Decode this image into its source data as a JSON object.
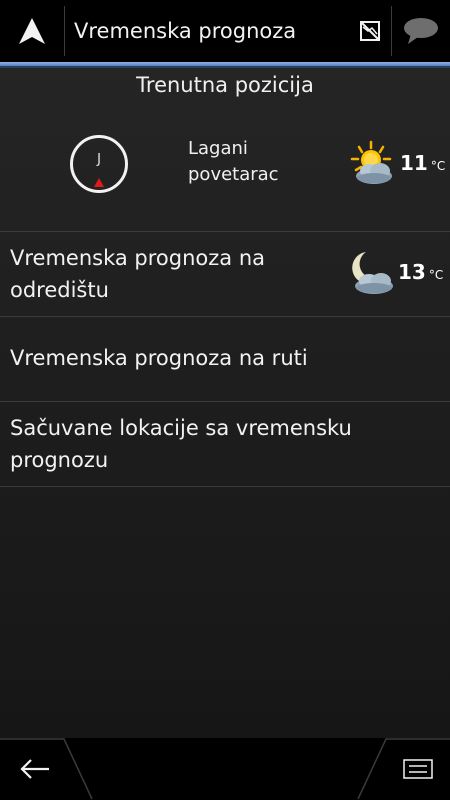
{
  "header": {
    "title": "Vremenska prognoza",
    "icons": [
      "navigation-arrow-icon",
      "map-off-icon",
      "message-icon"
    ]
  },
  "current_position": {
    "heading": "Trenutna pozicija",
    "compass_direction": "J",
    "wind_line1": "Lagani",
    "wind_line2": "povetarac",
    "weather_icon": "partly-cloudy-sun-icon",
    "temperature": "11",
    "unit": "°C"
  },
  "rows": [
    {
      "label_line1": "Vremenska prognoza na",
      "label_line2": "odredištu",
      "weather_icon": "cloud-moon-icon",
      "temperature": "13",
      "unit": "°C"
    },
    {
      "label_line1": "Vremenska prognoza na ruti"
    },
    {
      "label_line1": "Sačuvane lokacije sa vremensku",
      "label_line2": "prognozu"
    }
  ],
  "footer": {
    "icons": [
      "back-arrow-icon",
      "menu-icon"
    ]
  },
  "colors": {
    "accent": "#6f9bd6",
    "compass_pointer": "#e01a1a",
    "background": "#1d1d1d"
  }
}
